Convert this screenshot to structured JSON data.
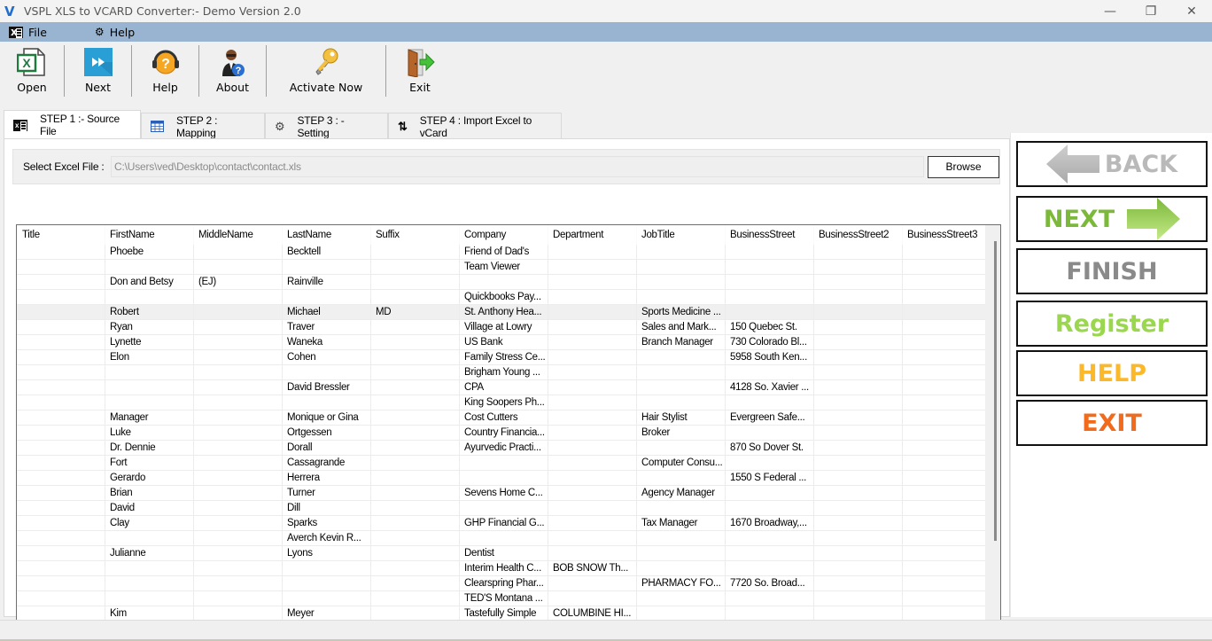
{
  "window": {
    "title": "VSPL XLS to VCARD Converter:- Demo Version 2.0",
    "controls": {
      "minimize": "—",
      "restore": "❐",
      "close": "✕"
    }
  },
  "menu": {
    "items": [
      {
        "label": "File",
        "icon": "excel-file-icon"
      },
      {
        "label": "Help",
        "icon": "gear-icon"
      }
    ]
  },
  "toolbar": {
    "buttons": [
      {
        "label": "Open",
        "icon": "excel-open-icon"
      },
      {
        "label": "Next",
        "icon": "fast-forward-icon"
      },
      {
        "label": "Help",
        "icon": "support-headset-icon"
      },
      {
        "label": "About",
        "icon": "user-question-icon"
      },
      {
        "label": "Activate Now",
        "icon": "keys-icon"
      },
      {
        "label": "Exit",
        "icon": "exit-door-icon"
      }
    ]
  },
  "tabs": [
    {
      "label": "STEP 1 :- Source File",
      "icon": "excel-file-icon",
      "active": true
    },
    {
      "label": "STEP 2 : Mapping",
      "icon": "table-grid-icon",
      "active": false
    },
    {
      "label": "STEP 3 : - Setting",
      "icon": "gear-icon",
      "active": false
    },
    {
      "label": "STEP 4 : Import Excel to vCard",
      "icon": "sort-arrows-icon",
      "active": false
    }
  ],
  "source": {
    "label": "Select Excel File :",
    "path": "C:\\Users\\ved\\Desktop\\contact\\contact.xls",
    "browse_label": "Browse"
  },
  "grid": {
    "columns": [
      "Title",
      "FirstName",
      "MiddleName",
      "LastName",
      "Suffix",
      "Company",
      "Department",
      "JobTitle",
      "BusinessStreet",
      "BusinessStreet2",
      "BusinessStreet3"
    ],
    "selected_row": 4,
    "rows": [
      [
        "",
        "Phoebe",
        "",
        "Becktell",
        "",
        "Friend of Dad's",
        "",
        "",
        "",
        "",
        ""
      ],
      [
        "",
        "",
        "",
        "",
        "",
        "Team Viewer",
        "",
        "",
        "",
        "",
        ""
      ],
      [
        "",
        "Don and Betsy",
        "(EJ)",
        "Rainville",
        "",
        "",
        "",
        "",
        "",
        "",
        ""
      ],
      [
        "",
        "",
        "",
        "",
        "",
        "Quickbooks Pay...",
        "",
        "",
        "",
        "",
        ""
      ],
      [
        "",
        "Robert",
        "",
        "Michael",
        "MD",
        "St. Anthony Hea...",
        "",
        "Sports Medicine ...",
        "",
        "",
        ""
      ],
      [
        "",
        "Ryan",
        "",
        "Traver",
        "",
        "Village at Lowry",
        "",
        "Sales and Mark...",
        "150 Quebec St.",
        "",
        ""
      ],
      [
        "",
        "Lynette",
        "",
        "Waneka",
        "",
        "US Bank",
        "",
        "Branch Manager",
        "730 Colorado Bl...",
        "",
        ""
      ],
      [
        "",
        "Elon",
        "",
        "Cohen",
        "",
        "Family Stress Ce...",
        "",
        "",
        "5958 South Ken...",
        "",
        ""
      ],
      [
        "",
        "",
        "",
        "",
        "",
        "Brigham Young ...",
        "",
        "",
        "",
        "",
        ""
      ],
      [
        "",
        "",
        "",
        "David Bressler",
        "",
        "CPA",
        "",
        "",
        "4128 So. Xavier ...",
        "",
        ""
      ],
      [
        "",
        "",
        "",
        "",
        "",
        "King Soopers Ph...",
        "",
        "",
        "",
        "",
        ""
      ],
      [
        "",
        "Manager",
        "",
        "Monique or Gina",
        "",
        "Cost Cutters",
        "",
        "Hair Stylist",
        "Evergreen Safe...",
        "",
        ""
      ],
      [
        "",
        "Luke",
        "",
        "Ortgessen",
        "",
        "Country Financia...",
        "",
        "Broker",
        "",
        "",
        ""
      ],
      [
        "",
        "Dr. Dennie",
        "",
        "Dorall",
        "",
        "Ayurvedic Practi...",
        "",
        "",
        "870 So Dover St.",
        "",
        ""
      ],
      [
        "",
        "Fort",
        "",
        "Cassagrande",
        "",
        "",
        "",
        "Computer Consu...",
        "",
        "",
        ""
      ],
      [
        "",
        "Gerardo",
        "",
        "Herrera",
        "",
        "",
        "",
        "",
        "1550 S Federal ...",
        "",
        ""
      ],
      [
        "",
        "Brian",
        "",
        "Turner",
        "",
        "Sevens Home C...",
        "",
        "Agency Manager",
        "",
        "",
        ""
      ],
      [
        "",
        "David",
        "",
        "Dill",
        "",
        "",
        "",
        "",
        "",
        "",
        ""
      ],
      [
        "",
        "Clay",
        "",
        "Sparks",
        "",
        "GHP Financial G...",
        "",
        "Tax Manager",
        "1670 Broadway,...",
        "",
        ""
      ],
      [
        "",
        "",
        "",
        "Averch Kevin R...",
        "",
        "",
        "",
        "",
        "",
        "",
        ""
      ],
      [
        "",
        "Julianne",
        "",
        "Lyons",
        "",
        "Dentist",
        "",
        "",
        "",
        "",
        ""
      ],
      [
        "",
        "",
        "",
        "",
        "",
        "Interim Health C...",
        "BOB SNOW Th...",
        "",
        "",
        "",
        ""
      ],
      [
        "",
        "",
        "",
        "",
        "",
        "Clearspring Phar...",
        "",
        "PHARMACY FO...",
        "7720 So. Broad...",
        "",
        ""
      ],
      [
        "",
        "",
        "",
        "",
        "",
        "TED'S Montana ...",
        "",
        "",
        "",
        "",
        ""
      ],
      [
        "",
        "Kim",
        "",
        "Meyer",
        "",
        "Tastefully Simple",
        "COLUMBINE HI...",
        "",
        "",
        "",
        ""
      ]
    ]
  },
  "side_buttons": [
    {
      "label": "BACK",
      "color": "#b9b9b9",
      "icon": "arrow-left-icon"
    },
    {
      "label": "NEXT",
      "color": "#7cb83a",
      "icon": "arrow-right-icon"
    },
    {
      "label": "FINISH",
      "color": "#8a8a8a"
    },
    {
      "label": "Register",
      "color": "#9ad64e"
    },
    {
      "label": "HELP",
      "color": "#fbb829"
    },
    {
      "label": "EXIT",
      "color": "#f26a1b"
    }
  ]
}
